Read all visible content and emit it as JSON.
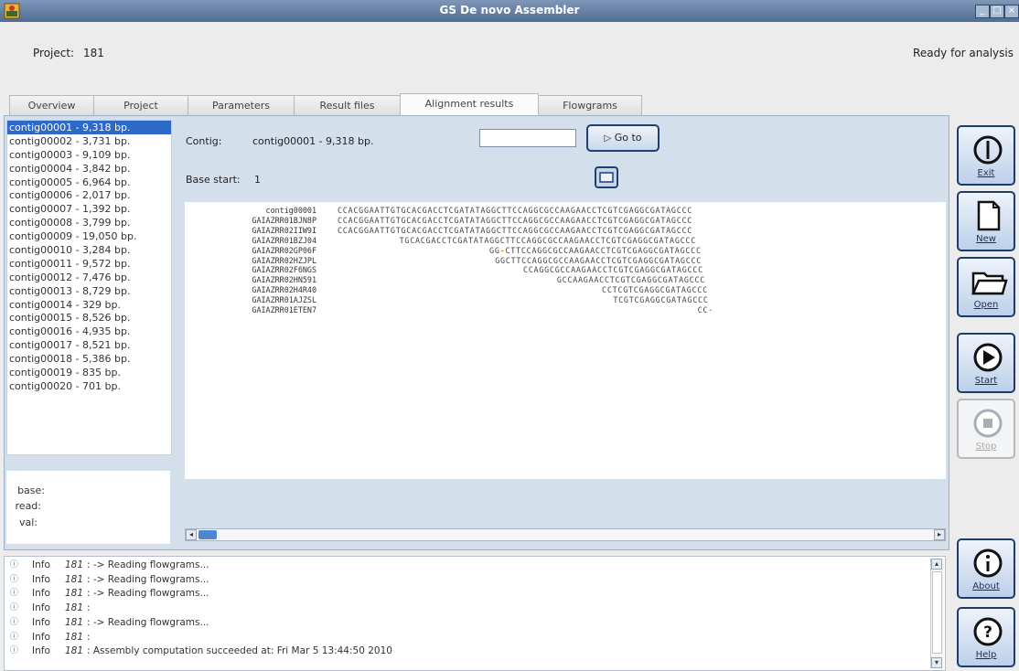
{
  "window": {
    "title": "GS De novo Assembler",
    "controls": [
      "_",
      "□",
      "×"
    ]
  },
  "header": {
    "project_label": "Project:",
    "project_value": "181",
    "status": "Ready for analysis"
  },
  "tabs": [
    {
      "label": "Overview",
      "active": false
    },
    {
      "label": "Project",
      "active": false
    },
    {
      "label": "Parameters",
      "active": false
    },
    {
      "label": "Result files",
      "active": false
    },
    {
      "label": "Alignment results",
      "active": true
    },
    {
      "label": "Flowgrams",
      "active": false
    }
  ],
  "contigs": [
    "contig00001 - 9,318 bp.",
    "contig00002 - 3,731 bp.",
    "contig00003 - 9,109 bp.",
    "contig00004 - 3,842 bp.",
    "contig00005 - 6,964 bp.",
    "contig00006 - 2,017 bp.",
    "contig00007 - 1,392 bp.",
    "contig00008 - 3,799 bp.",
    "contig00009 - 19,050 bp.",
    "contig00010 - 3,284 bp.",
    "contig00011 - 9,572 bp.",
    "contig00012 - 7,476 bp.",
    "contig00013 - 8,729 bp.",
    "contig00014 - 329 bp.",
    "contig00015 - 8,526 bp.",
    "contig00016 - 4,935 bp.",
    "contig00017 - 8,521 bp.",
    "contig00018 - 5,386 bp.",
    "contig00019 - 835 bp.",
    "contig00020 - 701 bp."
  ],
  "selected_contig_index": 0,
  "info_labels": {
    "base": "base:",
    "read": "read:",
    "val": "val:"
  },
  "alignment": {
    "contig_label": "Contig:",
    "contig_value": "contig00001 - 9,318 bp.",
    "goto_input": "",
    "goto_button": "Go to",
    "base_start_label": "Base start:",
    "base_start_value": "1",
    "rows": [
      {
        "name": "contig00001",
        "seq": "CCACGGAATTGTGCACGACCTCGATATAGGCTTCCAGGCGCCAAGAACCTCGTCGAGGCGATAGCCC",
        "offset": 0
      },
      {
        "name": "GAIAZRR01BJN8P",
        "seq": "CCACGGAATTGTGCACGACCTCGATATAGGCTTCCAGGCGCCAAGAACCTCGTCGAGGCGATAGCCC",
        "offset": 0
      },
      {
        "name": "GAIAZRR02IIW9I",
        "seq": "CCACGGAATTGTGCACGACCTCGATATAGGCTTCCAGGCGCCAAGAACCTCGTCGAGGCGATAGCCC",
        "offset": 0
      },
      {
        "name": "GAIAZRR01BZJ04",
        "seq": "TGCACGACCTCGATATAGGCTTCCAGGCGCCAAGAACCTCGTCGAGGCGATAGCCC",
        "offset": 11
      },
      {
        "name": "GAIAZRR02GP06F",
        "seq": "GG-CTTCCAGGCGCCAAGAACCTCGTCGAGGCGATAGCCC",
        "offset": 27
      },
      {
        "name": "GAIAZRR02HZJPL",
        "seq": "GGCTTCCAGGCGCCAAGAACCTCGTCGAGGCGATAGCCC",
        "offset": 28
      },
      {
        "name": "GAIAZRR02F6NGS",
        "seq": "CCAGGCGCCAAGAACCTCGTCGAGGCGATAGCCC",
        "offset": 33
      },
      {
        "name": "GAIAZRR02HN591",
        "seq": "GCCAAGAACCTCGTCGAGGCGATAGCCC",
        "offset": 39
      },
      {
        "name": "GAIAZRR02H4R40",
        "seq": "CCTCGTCGAGGCGATAGCCC",
        "offset": 47
      },
      {
        "name": "GAIAZRR01AJZSL",
        "seq": "TCGTCGAGGCGATAGCCC",
        "offset": 49
      },
      {
        "name": "GAIAZRR01ETEN7",
        "seq": "CC-",
        "offset": 64
      }
    ]
  },
  "log": [
    {
      "level": "Info",
      "project": "181",
      "message": ":  -> Reading flowgrams..."
    },
    {
      "level": "Info",
      "project": "181",
      "message": ":  -> Reading flowgrams..."
    },
    {
      "level": "Info",
      "project": "181",
      "message": ":  -> Reading flowgrams..."
    },
    {
      "level": "Info",
      "project": "181",
      "message": ":"
    },
    {
      "level": "Info",
      "project": "181",
      "message": ":  -> Reading flowgrams..."
    },
    {
      "level": "Info",
      "project": "181",
      "message": ":"
    },
    {
      "level": "Info",
      "project": "181",
      "message": ":  Assembly computation succeeded at: Fri Mar  5 13:44:50 2010"
    }
  ],
  "side_buttons": [
    {
      "label": "Exit",
      "icon": "power-icon",
      "enabled": true
    },
    {
      "label": "New",
      "icon": "new-document-icon",
      "enabled": true
    },
    {
      "label": "Open",
      "icon": "open-folder-icon",
      "enabled": true
    },
    {
      "label": "Start",
      "icon": "play-icon",
      "enabled": true
    },
    {
      "label": "Stop",
      "icon": "stop-icon",
      "enabled": false
    },
    {
      "label": "About",
      "icon": "info-icon",
      "enabled": true
    },
    {
      "label": "Help",
      "icon": "help-icon",
      "enabled": true
    }
  ],
  "colors": {
    "selection": "#2e68c8",
    "accent": "#1d3b6b",
    "gap_highlight": "#e8a000"
  }
}
